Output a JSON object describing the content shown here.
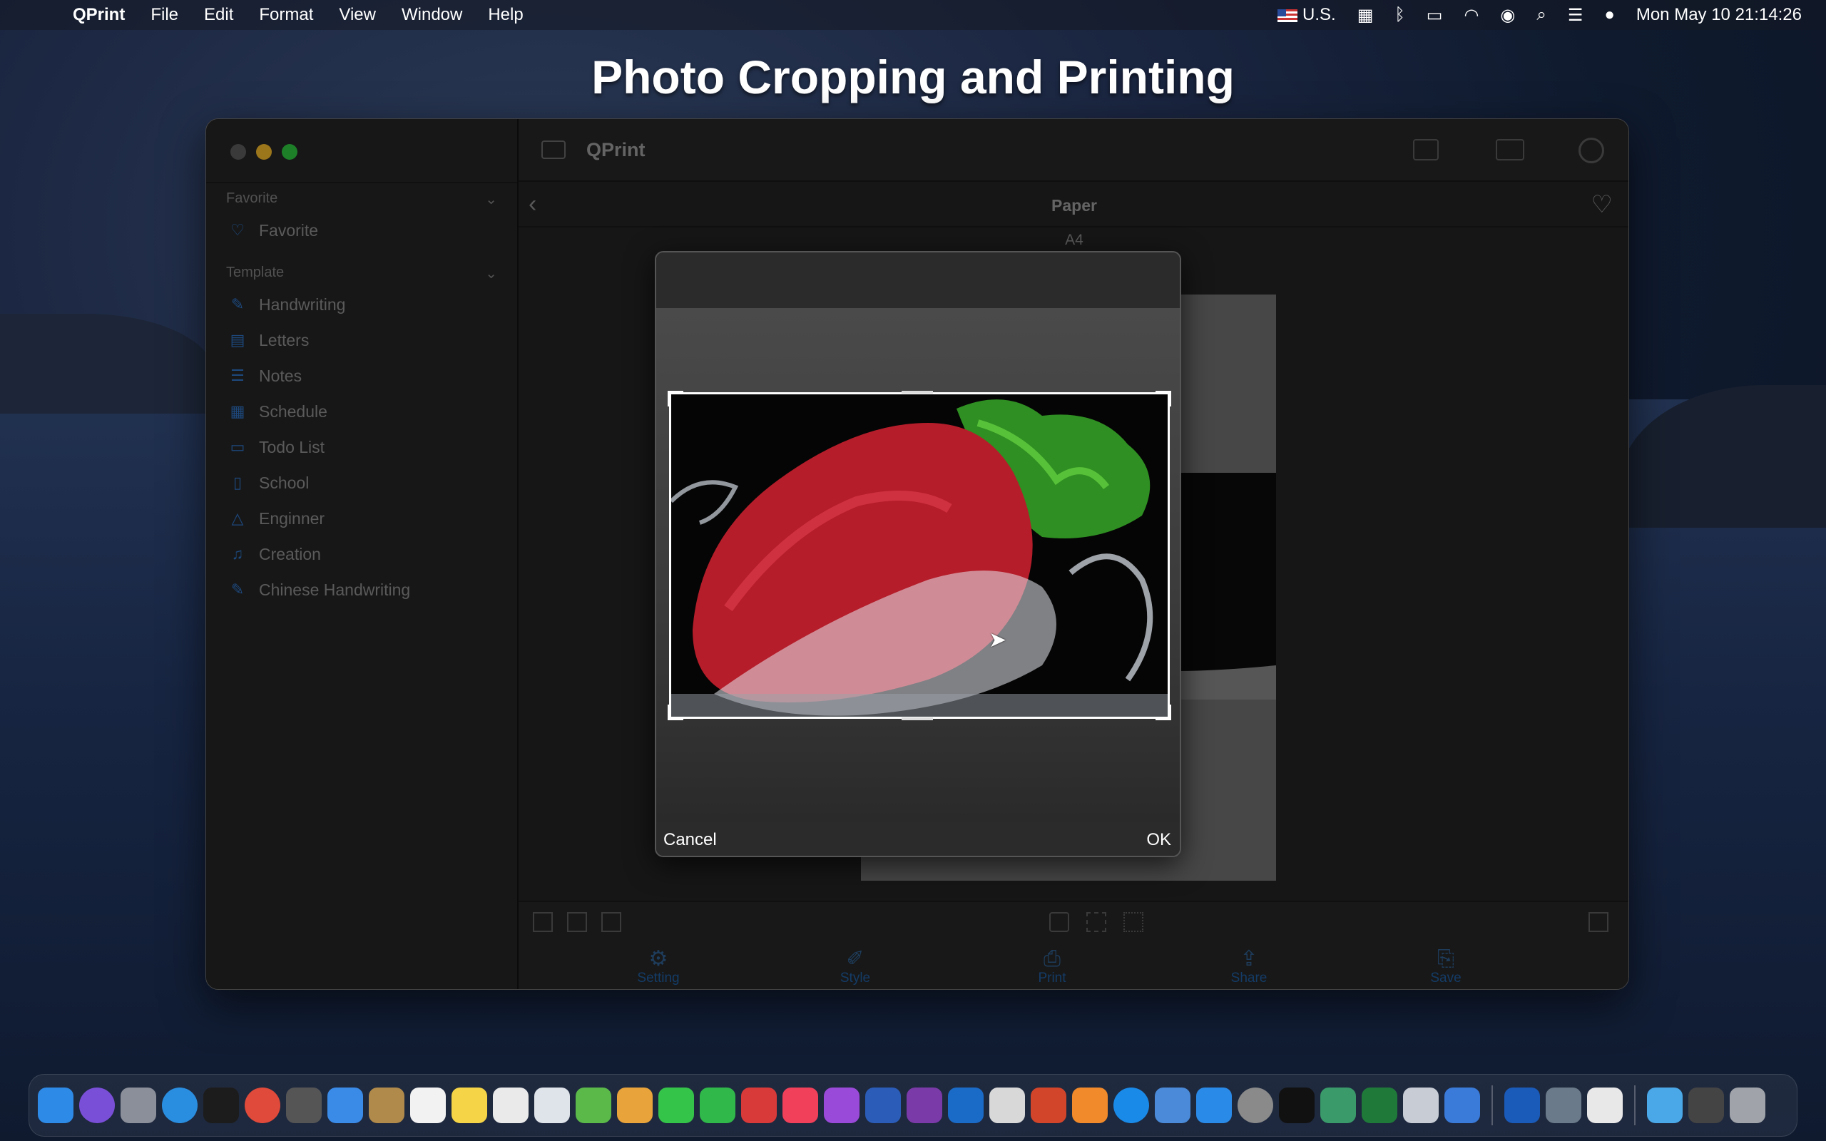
{
  "menubar": {
    "app_name": "QPrint",
    "items": [
      "File",
      "Edit",
      "Format",
      "View",
      "Window",
      "Help"
    ],
    "input_source": "U.S.",
    "clock": "Mon May 10  21:14:26"
  },
  "banner": {
    "title": "Photo Cropping and Printing"
  },
  "window": {
    "toolbar_title": "QPrint",
    "sidebar": {
      "favorite_header": "Favorite",
      "favorite_items": [
        {
          "label": "Favorite",
          "icon": "heart-icon"
        }
      ],
      "template_header": "Template",
      "template_items": [
        {
          "label": "Handwriting",
          "icon": "pen-icon"
        },
        {
          "label": "Letters",
          "icon": "letters-icon"
        },
        {
          "label": "Notes",
          "icon": "notes-icon"
        },
        {
          "label": "Schedule",
          "icon": "schedule-icon"
        },
        {
          "label": "Todo List",
          "icon": "todo-icon"
        },
        {
          "label": "School",
          "icon": "school-icon"
        },
        {
          "label": "Enginner",
          "icon": "triangle-icon"
        },
        {
          "label": "Creation",
          "icon": "music-icon"
        },
        {
          "label": "Chinese Handwriting",
          "icon": "pen-icon"
        }
      ]
    },
    "subbar_title": "Paper",
    "paper_size": "A4",
    "tabs": [
      {
        "label": "Setting",
        "icon": "gear-icon"
      },
      {
        "label": "Style",
        "icon": "brush-icon"
      },
      {
        "label": "Print",
        "icon": "printer-icon"
      },
      {
        "label": "Share",
        "icon": "share-icon"
      },
      {
        "label": "Save",
        "icon": "save-icon"
      }
    ]
  },
  "dialog": {
    "cancel_label": "Cancel",
    "ok_label": "OK"
  },
  "colors": {
    "accent": "#2d6fbf",
    "tab_blue": "#1f5c9e"
  }
}
